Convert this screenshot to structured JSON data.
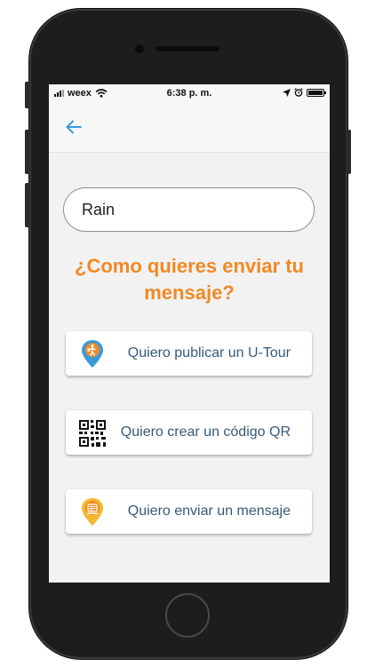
{
  "status_bar": {
    "carrier": "weex",
    "time": "6:38 p. m."
  },
  "name_input": {
    "value": "Rain"
  },
  "question": {
    "line1": "¿Como quieres enviar tu",
    "line2": "mensaje?"
  },
  "options": [
    {
      "label": "Quiero publicar un U-Tour",
      "icon": "tour-pin-icon"
    },
    {
      "label": "Quiero crear un código QR",
      "icon": "qr-code-icon"
    },
    {
      "label": "Quiero enviar un mensaje",
      "icon": "message-pin-icon"
    }
  ],
  "colors": {
    "accent_orange": "#f08a24",
    "back_arrow": "#3a9ad9",
    "label_text": "#355a7a",
    "pin_blue": "#3a9ad9",
    "pin_yellow": "#f5b82e"
  }
}
